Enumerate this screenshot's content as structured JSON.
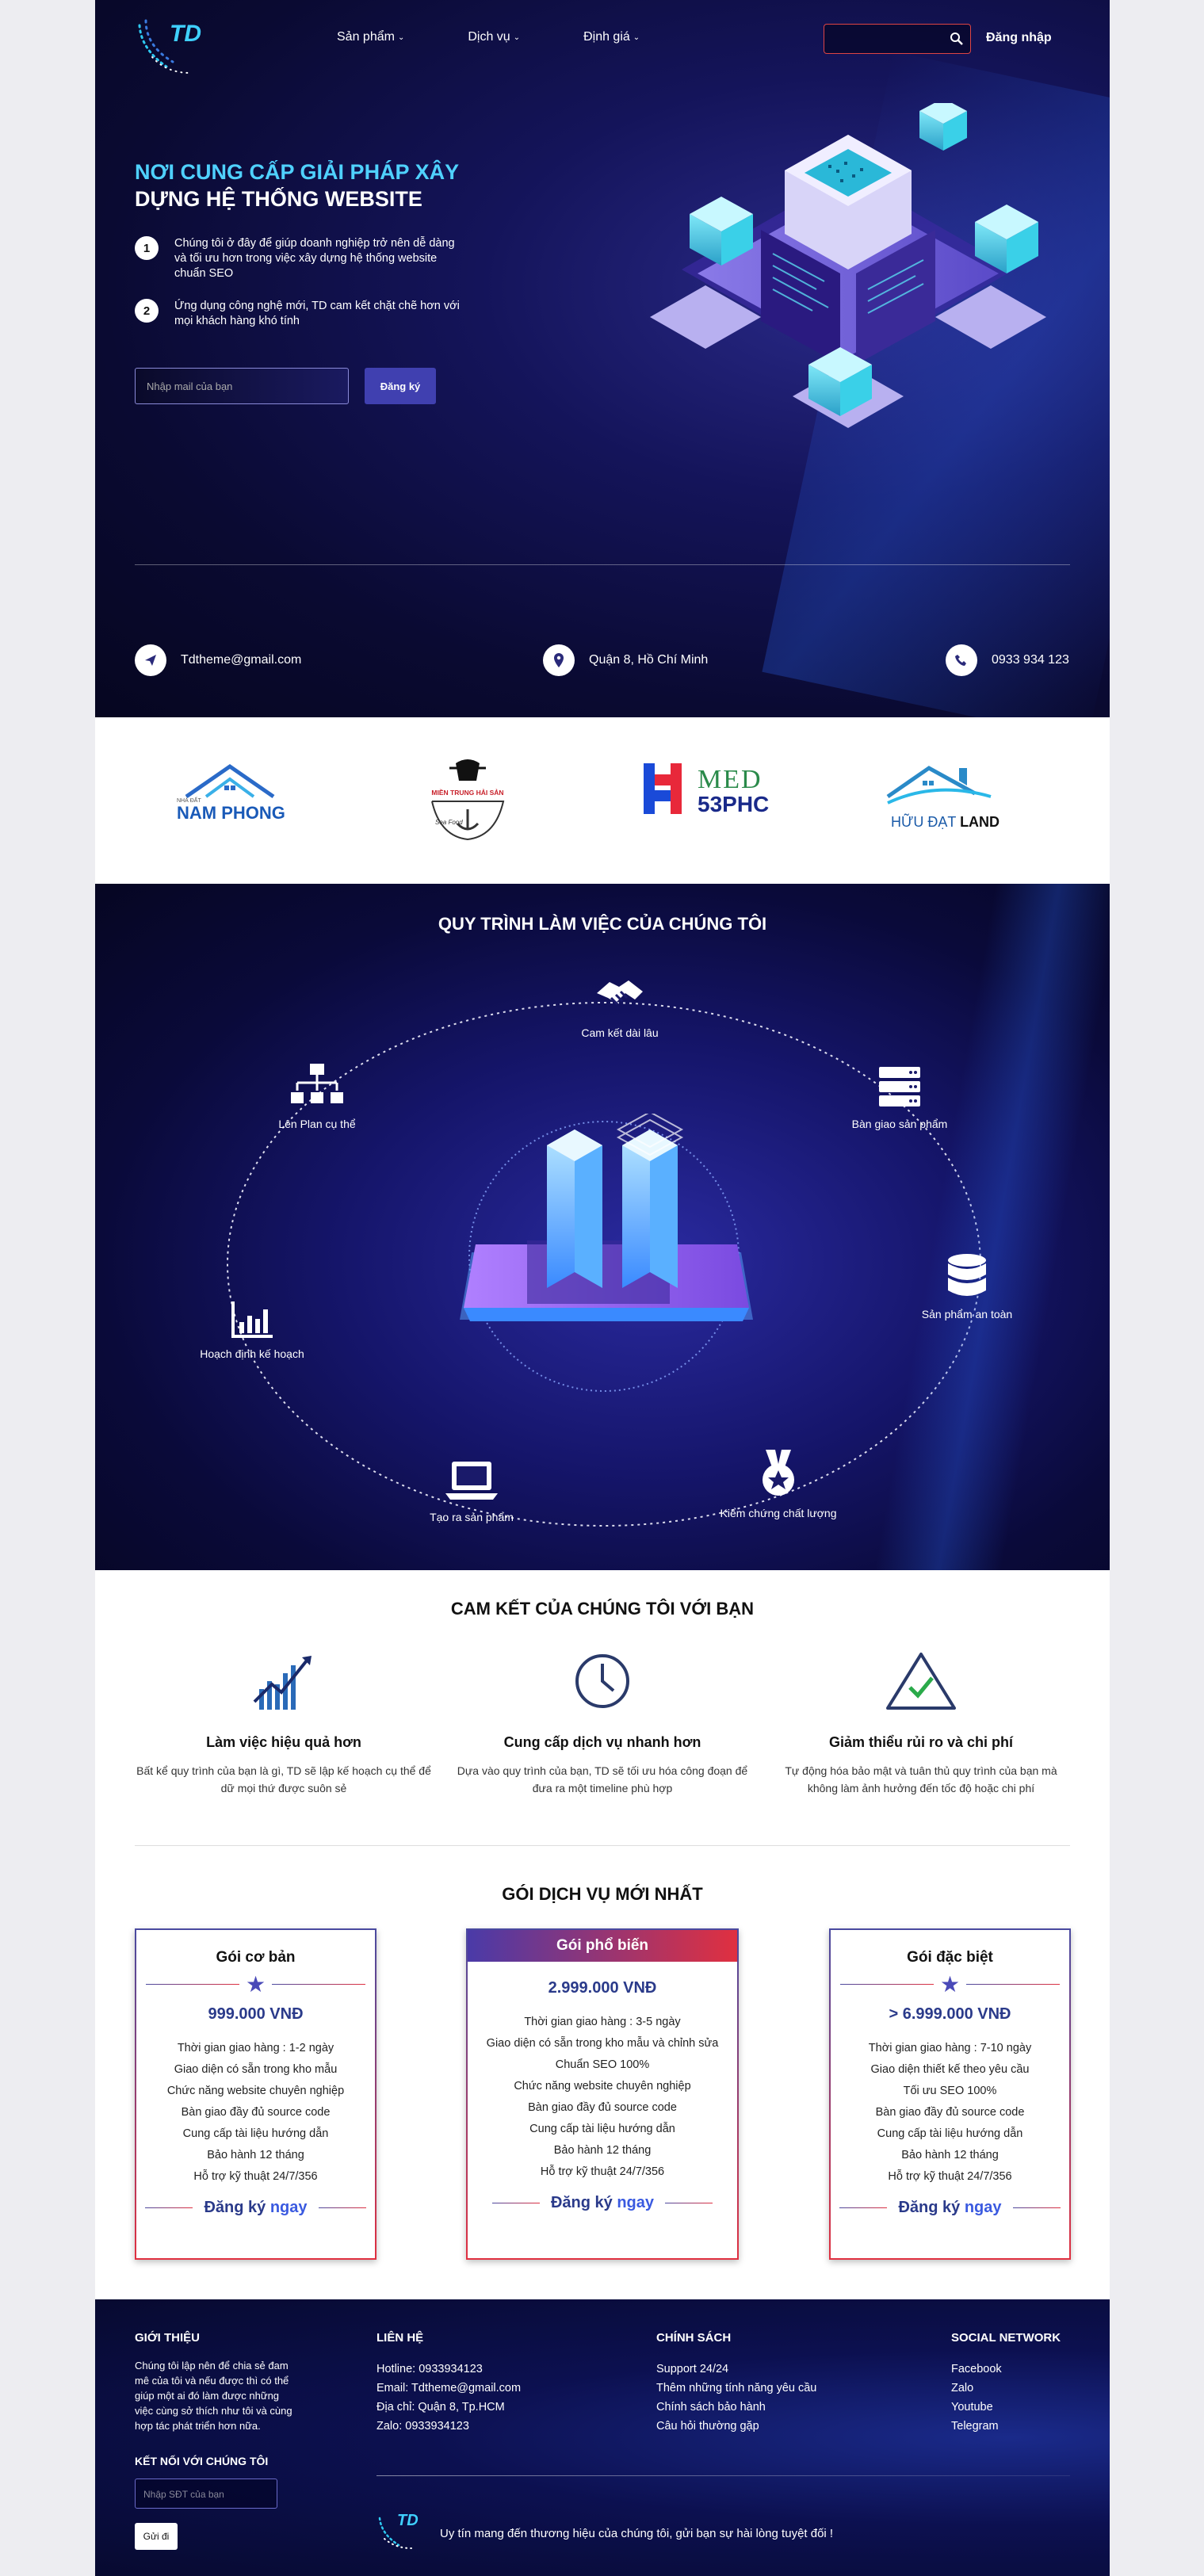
{
  "nav": {
    "logo_text": "TD",
    "items": [
      "Sản phẩm",
      "Dịch vụ",
      "Định giá"
    ],
    "login": "Đăng nhập"
  },
  "hero": {
    "title_line1": "NƠI CUNG CẤP GIẢI PHÁP XÂY",
    "title_line2": "DỰNG HỆ THỐNG WEBSITE",
    "features": [
      {
        "num": "1",
        "text": "Chúng tôi ở đây để giúp doanh nghiệp trở nên dễ dàng và tối ưu hơn trong việc xây dựng hệ thống website chuẩn SEO"
      },
      {
        "num": "2",
        "text": "Ứng dụng công nghệ mới, TD cam kết chặt chẽ hơn với mọi khách hàng khó tính"
      }
    ],
    "email_placeholder": "Nhập mail của bạn",
    "subscribe": "Đăng ký"
  },
  "contact": {
    "email": "Tdtheme@gmail.com",
    "address": "Quận 8, Hồ Chí Minh",
    "phone": "0933 934 123"
  },
  "partners": [
    {
      "line1": "NHÀ ĐẤT",
      "line2": "NAM PHONG"
    },
    {
      "line1": "MIỀN TRUNG HẢI SẢN",
      "line2": "Sea Food"
    },
    {
      "line1": "MED",
      "line2": "53PHC"
    },
    {
      "line1": "HỮU ĐẠT",
      "line2": "LAND"
    }
  ],
  "process": {
    "title": "QUY TRÌNH LÀM VIỆC CỦA CHÚNG TÔI",
    "steps": [
      "Cam kết dài lâu",
      "Bàn giao sản phẩm",
      "Sản phẩm an toàn",
      "Kiểm chứng chất lượng",
      "Tạo ra sản phẩm",
      "Hoạch định kế hoạch",
      "Lên Plan cụ thể"
    ]
  },
  "commit": {
    "title": "CAM KẾT CỦA CHÚNG TÔI VỚI BẠN",
    "items": [
      {
        "title": "Làm việc hiệu quả hơn",
        "text": "Bất kể quy trình của bạn là gì, TD sẽ lập kế hoạch cụ thể để dữ mọi thứ được suôn sẻ"
      },
      {
        "title": "Cung cấp dịch vụ nhanh hơn",
        "text": "Dựa vào quy trình của bạn, TD sẽ tối ưu hóa công đoạn để đưa ra một timeline phù hợp"
      },
      {
        "title": "Giảm thiểu rủi ro và chi phí",
        "text": "Tự động hóa bảo mật và tuân thủ quy trình của bạn mà không làm ảnh hưởng đến tốc độ hoặc chi phí"
      }
    ]
  },
  "pricing": {
    "title": "GÓI DỊCH VỤ MỚI NHẤT",
    "cta_a": "Đăng ký",
    "cta_b": "ngay",
    "plans": [
      {
        "name": "Gói cơ bản",
        "price": "999.000 VNĐ",
        "features": [
          "Thời gian giao hàng : 1-2 ngày",
          "Giao diện có sẵn trong kho mẫu",
          "Chức năng website chuyên nghiệp",
          "Bàn giao đầy đủ source code",
          "Cung cấp tài liệu hướng dẫn",
          "Bảo hành 12 tháng",
          "Hỗ trợ kỹ thuật 24/7/356"
        ]
      },
      {
        "name": "Gói phổ biến",
        "price": "2.999.000 VNĐ",
        "features": [
          "Thời gian giao hàng : 3-5 ngày",
          "Giao diện có sẵn trong kho mẫu và chỉnh sửa",
          "Chuẩn SEO 100%",
          "Chức năng website chuyên nghiệp",
          "Bàn giao đầy đủ source code",
          "Cung cấp tài liệu hướng dẫn",
          "Bảo hành 12 tháng",
          "Hỗ trợ kỹ thuật 24/7/356"
        ]
      },
      {
        "name": "Gói đặc biệt",
        "price": "> 6.999.000 VNĐ",
        "features": [
          "Thời gian giao hàng : 7-10 ngày",
          "Giao diện thiết kế theo yêu cầu",
          "Tối ưu SEO 100%",
          "Bàn giao đầy đủ source code",
          "Cung cấp tài liệu hướng dẫn",
          "Bảo hành 12 tháng",
          "Hỗ trợ kỹ thuật 24/7/356"
        ]
      }
    ]
  },
  "footer": {
    "about_title": "GIỚI THIỆU",
    "about_text": "Chúng tôi lập nên để chia sẻ đam mê của tôi và nếu được thì có thể giúp một ai đó làm được những việc cùng sở thích như tôi và cùng hợp tác phát triển hơn nữa.",
    "connect_title": "KẾT NỐI VỚI CHÚNG TÔI",
    "phone_placeholder": "Nhập SĐT của bạn",
    "send": "Gửi đi",
    "contact_title": "LIÊN HỆ",
    "contact_lines": [
      "Hotline: 0933934123",
      "Email: Tdtheme@gmail.com",
      "Địa chỉ: Quận 8, Tp.HCM",
      "Zalo: 0933934123"
    ],
    "policy_title": "CHÍNH SÁCH",
    "policy_lines": [
      "Support 24/24",
      "Thêm những tính năng yêu cầu",
      "Chính sách bảo hành",
      "Câu hỏi thường gặp"
    ],
    "social_title": "SOCIAL NETWORK",
    "social_lines": [
      "Facebook",
      "Zalo",
      "Youtube",
      "Telegram"
    ],
    "tagline": "Uy tín mang đến thương hiệu của chúng tôi, gửi bạn sự hài lòng tuyệt đối !"
  }
}
